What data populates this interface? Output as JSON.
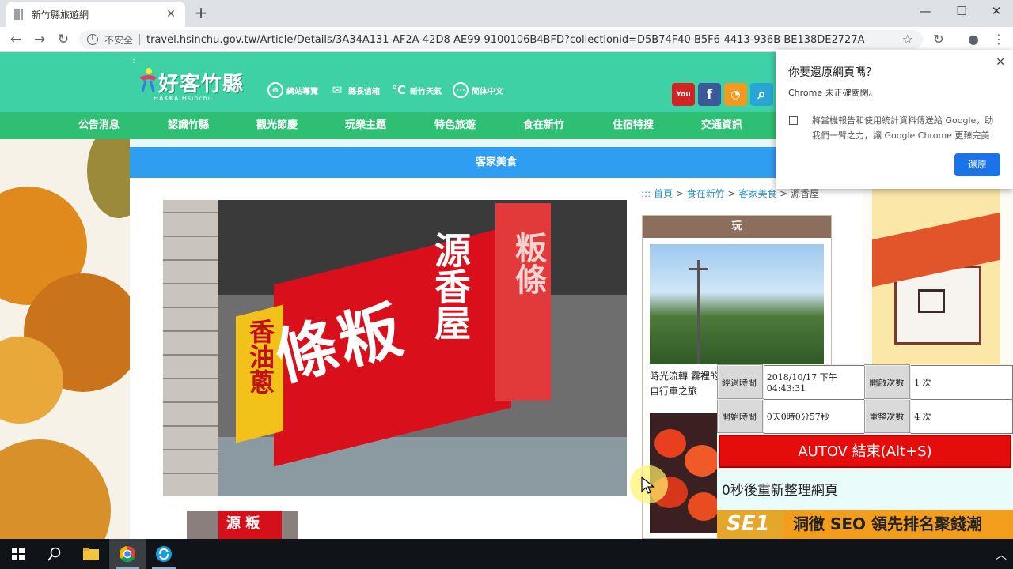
{
  "browser": {
    "tab_title": "新竹縣旅遊網",
    "tab_close": "✕",
    "new_tab": "+",
    "minimize": "—",
    "maximize": "☐",
    "close": "✕",
    "insecure_label": "不安全",
    "url": "travel.hsinchu.gov.tw/Article/Details/3A34A131-AF2A-42D8-AE99-9100106B4BFD?collectionid=D5B74F40-B5F6-4413-936B-BE138DE2727A"
  },
  "site": {
    "logo_text": "好客竹縣",
    "logo_sub": "HAKKA  Hsinchu",
    "quicklinks": [
      {
        "icon": "globe-icon",
        "glyph": "⊕",
        "label": "網站導覽"
      },
      {
        "icon": "mail-icon",
        "glyph": "✉",
        "label": "縣長信箱"
      },
      {
        "icon": "celsius-icon",
        "glyph": "℃",
        "label": "新竹天氣"
      },
      {
        "icon": "chat-icon",
        "glyph": "···",
        "label": "简体中文"
      }
    ],
    "social": [
      {
        "name": "youtube-icon",
        "glyph": "You",
        "color": "#d32424"
      },
      {
        "name": "facebook-icon",
        "glyph": "f",
        "color": "#3b5998"
      },
      {
        "name": "rss-icon",
        "glyph": "◔",
        "color": "#f39a1e"
      },
      {
        "name": "search-icon",
        "glyph": "⌕",
        "color": "#2aa6d6"
      }
    ],
    "nav": [
      "公告消息",
      "認識竹縣",
      "觀光節慶",
      "玩樂主題",
      "特色旅遊",
      "食在新竹",
      "住宿特搜",
      "交通資訊"
    ],
    "category_title": "客家美食",
    "breadcrumb": {
      "prefix": ":::",
      "items": [
        "首頁",
        "食在新竹",
        "客家美食"
      ],
      "current": "源香屋",
      "sep": ">"
    },
    "sign": {
      "main": "條粄",
      "brand": "源香屋",
      "side": "香油蔥",
      "right": "粄條"
    },
    "thumb_text": "源 粄",
    "side_title": "玩",
    "side_caption": "時光流轉 霧裡的自行車之旅"
  },
  "restore_popup": {
    "title": "你要還原網頁嗎？",
    "message": "Chrome 未正確關閉。",
    "checkbox_text": "將當機報告和使用統計資料傳送給 Google，助我們一臂之力，讓 Google Chrome 更臻完美",
    "button": "還原",
    "close": "✕"
  },
  "autov": {
    "label_elapsed": "經過時間",
    "value_elapsed": "2018/10/17 下午 04:43:31",
    "label_open_count": "開啟次數",
    "value_open_count": "1 次",
    "label_start": "開始時間",
    "value_start": "0天0時0分57秒",
    "label_reload_count": "重整次數",
    "value_reload_count": "4 次",
    "stop_button": "AUTOV 結束(Alt+S)",
    "countdown": "0秒後重新整理網頁",
    "banner_brand": "SE1",
    "banner_text": "洞徹 SEO 領先排名聚錢潮"
  }
}
